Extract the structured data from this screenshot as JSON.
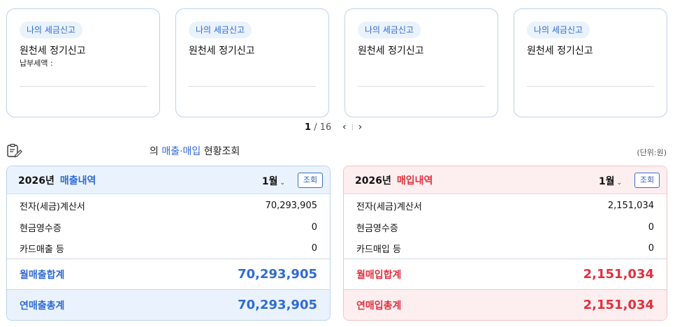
{
  "cards": [
    {
      "badge": "나의 세금신고",
      "title": "원천세 정기신고",
      "sub": "납부세액 :"
    },
    {
      "badge": "나의 세금신고",
      "title": "원천세 정기신고",
      "sub": ""
    },
    {
      "badge": "나의 세금신고",
      "title": "원천세 정기신고",
      "sub": ""
    },
    {
      "badge": "나의 세금신고",
      "title": "원천세 정기신고",
      "sub": ""
    }
  ],
  "pager": {
    "current": "1",
    "sep": "/",
    "total": "16",
    "prev": "‹",
    "next": "›"
  },
  "section": {
    "prefix": "의 ",
    "highlight": "매출·매입",
    "suffix": " 현황조회",
    "unit": "(단위:원)"
  },
  "sales": {
    "year": "2026년",
    "kind": "매출내역",
    "month": "1월",
    "query_label": "조회",
    "rows": [
      {
        "label": "전자(세금)계산서",
        "value": "70,293,905"
      },
      {
        "label": "현금영수증",
        "value": "0"
      },
      {
        "label": "카드매출 등",
        "value": "0"
      }
    ],
    "monthly_label": "월매출합계",
    "monthly_value": "70,293,905",
    "annual_label": "연매출총계",
    "annual_value": "70,293,905"
  },
  "purchase": {
    "year": "2026년",
    "kind": "매입내역",
    "month": "1월",
    "query_label": "조회",
    "rows": [
      {
        "label": "전자(세금)계산서",
        "value": "2,151,034"
      },
      {
        "label": "현금영수증",
        "value": "0"
      },
      {
        "label": "카드매입 등",
        "value": "0"
      }
    ],
    "monthly_label": "월매입합계",
    "monthly_value": "2,151,034",
    "annual_label": "연매입총계",
    "annual_value": "2,151,034"
  },
  "colors": {
    "accent_blue": "#2f6bd1",
    "accent_red": "#e0313f"
  },
  "icons": {
    "section": "clipboard-pen-icon",
    "month": "chevron-down-icon"
  }
}
